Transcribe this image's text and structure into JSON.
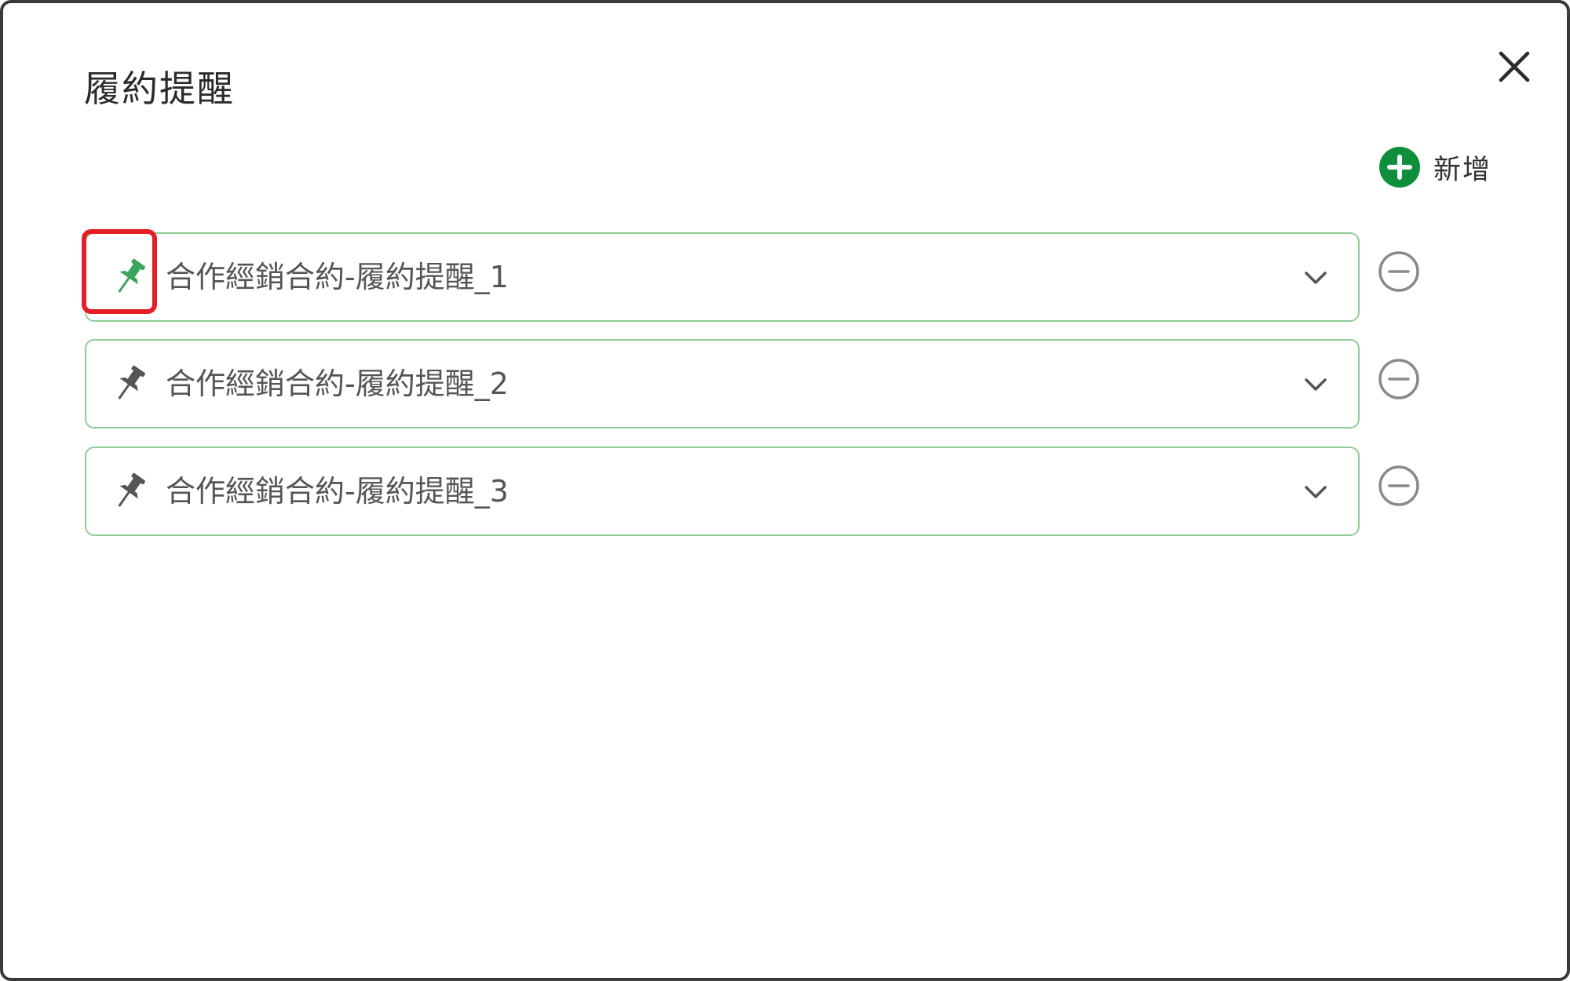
{
  "dialog": {
    "title": "履約提醒",
    "close_icon": "close-icon",
    "add_button": {
      "label": "新增",
      "icon": "plus-circle-icon",
      "color": "#0f8f3c"
    }
  },
  "reminders": [
    {
      "label": "合作經銷合約-履約提醒_1",
      "pinned": true,
      "pin_icon": "pushpin-icon",
      "expand_icon": "chevron-down-icon",
      "remove_icon": "minus-circle-icon"
    },
    {
      "label": "合作經銷合約-履約提醒_2",
      "pinned": false,
      "pin_icon": "pushpin-icon",
      "expand_icon": "chevron-down-icon",
      "remove_icon": "minus-circle-icon"
    },
    {
      "label": "合作經銷合約-履約提醒_3",
      "pinned": false,
      "pin_icon": "pushpin-icon",
      "expand_icon": "chevron-down-icon",
      "remove_icon": "minus-circle-icon"
    }
  ],
  "colors": {
    "pinned": "#3ca55c",
    "unpinned": "#555555",
    "row_border": "#8fcc95",
    "highlight": "#e41e26"
  }
}
